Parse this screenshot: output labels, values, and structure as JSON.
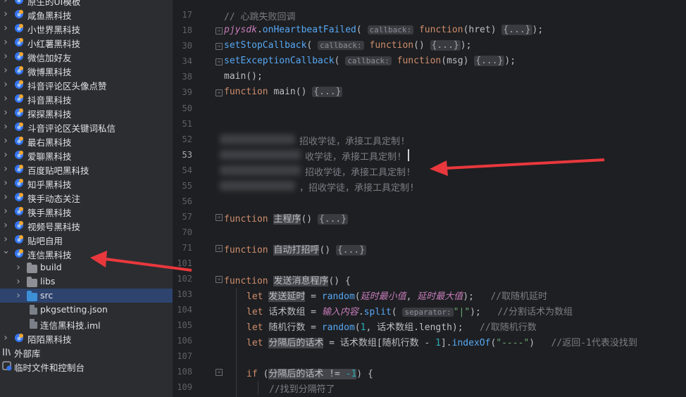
{
  "sidebar": {
    "items": [
      {
        "label": "原生的UI模板",
        "type": "project"
      },
      {
        "label": "咸鱼黑科技",
        "type": "project"
      },
      {
        "label": "小世界黑科技",
        "type": "project"
      },
      {
        "label": "小红薯黑科技",
        "type": "project"
      },
      {
        "label": "微信加好友",
        "type": "project"
      },
      {
        "label": "微博黑科技",
        "type": "project"
      },
      {
        "label": "抖音评论区头像点赞",
        "type": "project"
      },
      {
        "label": "抖音黑科技",
        "type": "project"
      },
      {
        "label": "探探黑科技",
        "type": "project"
      },
      {
        "label": "斗音评论区关键词私信",
        "type": "project"
      },
      {
        "label": "最右黑科技",
        "type": "project"
      },
      {
        "label": "爱聊黑科技",
        "type": "project"
      },
      {
        "label": "百度贴吧黑科技",
        "type": "project"
      },
      {
        "label": "知乎黑科技",
        "type": "project"
      },
      {
        "label": "筷手动态关注",
        "type": "project"
      },
      {
        "label": "筷手黑科技",
        "type": "project"
      },
      {
        "label": "视频号黑科技",
        "type": "project"
      },
      {
        "label": "贴吧自用",
        "type": "project"
      },
      {
        "label": "连信黑科技",
        "type": "project",
        "expanded": true
      },
      {
        "label": "build",
        "type": "folder",
        "indent": 1
      },
      {
        "label": "libs",
        "type": "folder",
        "indent": 1
      },
      {
        "label": "src",
        "type": "src-folder",
        "indent": 1,
        "selected": true
      },
      {
        "label": "pkgsetting.json",
        "type": "file",
        "indent": 1
      },
      {
        "label": "连信黑科技.iml",
        "type": "file",
        "indent": 1
      },
      {
        "label": "陌陌黑科技",
        "type": "project"
      }
    ],
    "external_libs": "外部库",
    "scratches": "临时文件和控制台"
  },
  "editor": {
    "line_numbers": [
      "17",
      "18",
      "30",
      "34",
      "38",
      "39",
      "50",
      "51",
      "52",
      "53",
      "54",
      "55",
      "56",
      "57",
      "70",
      "71",
      "101",
      "102",
      "103",
      "104",
      "105",
      "106",
      "107",
      "108",
      "109"
    ],
    "current_line": "53",
    "lines": {
      "l17": "// 心跳失败回调",
      "l18": {
        "obj": "pjysdk",
        "method": "onHeartbeatFailed",
        "hint": "callback:",
        "kw": "function",
        "param": "hret",
        "body": "{...}"
      },
      "l30": {
        "method": "setStopCallback",
        "hint": "callback:",
        "kw": "function",
        "body": "{...}"
      },
      "l34": {
        "method": "setExceptionCallback",
        "hint": "callback:",
        "kw": "function",
        "param": "msg",
        "body": "{...}"
      },
      "l38": "main();",
      "l39": {
        "kw": "function",
        "name": "main",
        "body": "{...}"
      },
      "l52": "招收学徒，承接工具定制!",
      "l53": "收学徒，承接工具定制!",
      "l54": "招收学徒，承接工具定制!",
      "l55": "，招收学徒，承接工具定制!",
      "l57": {
        "kw": "function",
        "name": "主程序",
        "body": "{...}"
      },
      "l71": {
        "kw": "function",
        "name": "自动打招呼",
        "body": "{...}"
      },
      "l102": {
        "kw": "function",
        "name": "发送消息程序"
      },
      "l103": {
        "kw": "let",
        "var": "发送延时",
        "fn": "random",
        "a1": "延时最小值",
        "a2": "延时最大值",
        "comment": "//取随机延时"
      },
      "l104": {
        "kw": "let",
        "var": "话术数组",
        "src": "输入内容",
        "fn": "split",
        "hint": "separator:",
        "str": "\"|\"",
        "comment": "//分割话术为数组"
      },
      "l105": {
        "kw": "let",
        "var": "随机行数",
        "fn": "random",
        "n1": "1",
        "arr": "话术数组",
        "prop": "length",
        "comment": "//取随机行数"
      },
      "l106": {
        "kw": "let",
        "var": "分隔后的话术",
        "arr": "话术数组",
        "idx": "随机行数",
        "n1": "1",
        "fn": "indexOf",
        "str": "\"----\"",
        "comment": "//返回-1代表没找到"
      },
      "l108": {
        "kw": "if",
        "var": "分隔后的话术",
        "op": "!=",
        "num": "-1"
      },
      "l109": "//找到分隔符了"
    }
  },
  "annotations": {
    "arrow_color": "#e8383d"
  }
}
